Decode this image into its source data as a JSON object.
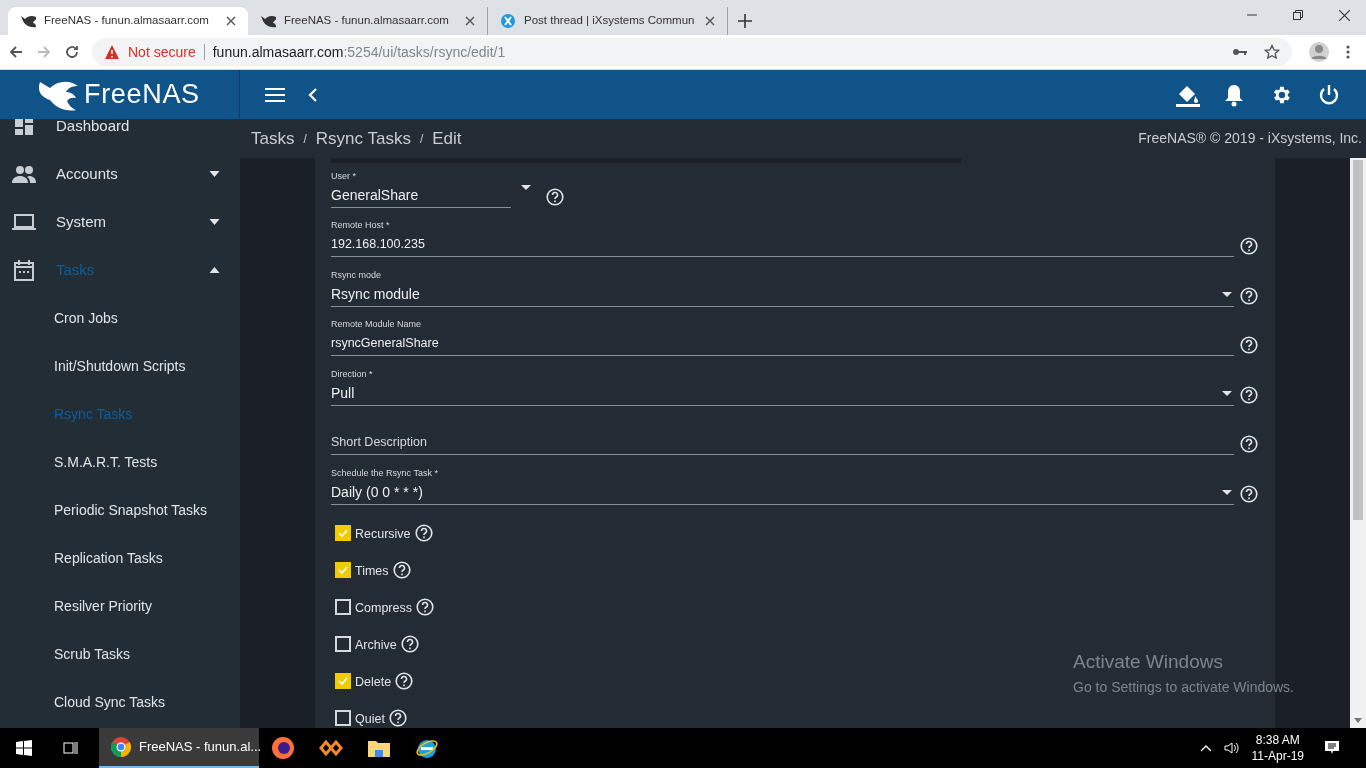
{
  "browser": {
    "tabs": [
      {
        "title": "FreeNAS - funun.almasaarr.com",
        "selected": true
      },
      {
        "title": "FreeNAS - funun.almasaarr.com",
        "selected": false
      },
      {
        "title": "Post thread | iXsystems Commun",
        "selected": false
      }
    ],
    "security": "Not secure",
    "url_host": "funun.almasaarr.com",
    "url_path": ":5254/ui/tasks/rsync/edit/1"
  },
  "app": {
    "logo": "FreeNAS",
    "sidebar": [
      {
        "label": "Dashboard",
        "selected": false
      },
      {
        "label": "Accounts",
        "selected": false,
        "expanded": false
      },
      {
        "label": "System",
        "selected": false,
        "expanded": false
      },
      {
        "label": "Tasks",
        "selected": true,
        "expanded": true,
        "children": [
          {
            "label": "Cron Jobs",
            "selected": false
          },
          {
            "label": "Init/Shutdown Scripts",
            "selected": false
          },
          {
            "label": "Rsync Tasks",
            "selected": true
          },
          {
            "label": "S.M.A.R.T. Tests",
            "selected": false
          },
          {
            "label": "Periodic Snapshot Tasks",
            "selected": false
          },
          {
            "label": "Replication Tasks",
            "selected": false
          },
          {
            "label": "Resilver Priority",
            "selected": false
          },
          {
            "label": "Scrub Tasks",
            "selected": false
          },
          {
            "label": "Cloud Sync Tasks",
            "selected": false
          }
        ]
      }
    ],
    "breadcrumb": [
      "Tasks",
      "Rsync Tasks",
      "Edit"
    ],
    "breadcrumb_separator": "/",
    "copyright": "FreeNAS® © 2019 - iXsystems, Inc.",
    "form": {
      "fields": [
        {
          "kind": "select",
          "label": "User *",
          "value": "GeneralShare",
          "narrow": true
        },
        {
          "kind": "input",
          "label": "Remote Host *",
          "value": "192.168.100.235"
        },
        {
          "kind": "select",
          "label": "Rsync mode",
          "value": "Rsync module"
        },
        {
          "kind": "input",
          "label": "Remote Module Name",
          "value": "rsyncGeneralShare"
        },
        {
          "kind": "select",
          "label": "Direction *",
          "value": "Pull"
        },
        {
          "kind": "input",
          "placeholder": "Short Description"
        },
        {
          "kind": "select",
          "label": "Schedule the Rsync Task *",
          "value": "Daily (0 0 * * *)"
        }
      ],
      "checkboxes": [
        {
          "label": "Recursive",
          "checked": true
        },
        {
          "label": "Times",
          "checked": true
        },
        {
          "label": "Compress",
          "checked": false
        },
        {
          "label": "Archive",
          "checked": false
        },
        {
          "label": "Delete",
          "checked": true
        },
        {
          "label": "Quiet",
          "checked": false
        }
      ]
    }
  },
  "os_notice": {
    "title": "Activate Windows",
    "text": "Go to Settings to activate Windows."
  },
  "taskbar": {
    "active_app": "FreeNAS - funun.al...",
    "time": "8:38 AM",
    "date": "11-Apr-19"
  }
}
